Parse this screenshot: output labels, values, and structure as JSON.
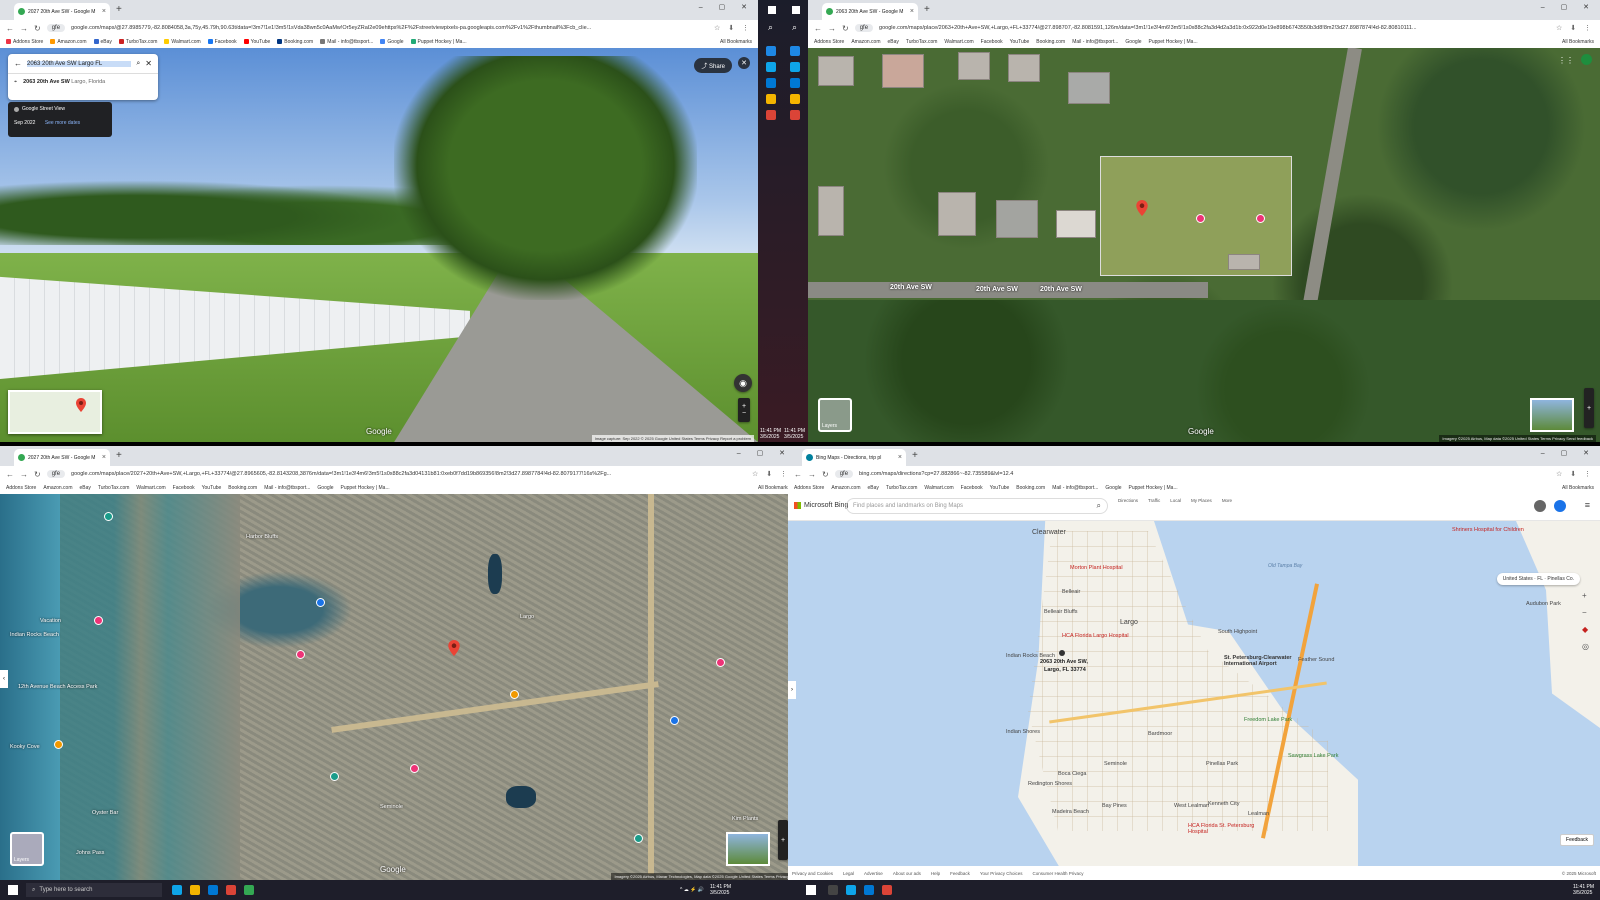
{
  "bookmarks": [
    "Addons Store",
    "Amazon.com",
    "eBay",
    "TurboTax.com",
    "Walmart.com",
    "Facebook",
    "YouTube",
    "Booking.com",
    "Mail - info@tbsport...",
    "Google",
    "Puppet Hockey | Ma..."
  ],
  "all_bookmarks": "All Bookmarks",
  "tl": {
    "tab_title": "2027 20th Ave SW - Google M",
    "url_pill": "gfe",
    "url": "google.com/maps/@27.8985779,-82.8084058,3a,75y,45.79h,90.63t/data=!3m7!1e1!3m5!1sVda38wn5c0AaMw!Or5eyZRaI2e09ehttps%2F%2Fstreetviewpixels-pa.googleapis.com%2Fv1%2Fthumbnail%3Fcb_clie...",
    "search_value": "2063 20th Ave SW Largo FL",
    "suggestion_bold": "2063 20th Ave SW",
    "suggestion_rest": " Largo, Florida",
    "sv_label": "Google Street View",
    "sv_date": "Sep 2022",
    "see_more": "See more dates",
    "share": "Share",
    "watermark": "Google",
    "footer": "Image capture: Sep 2022   © 2025 Google   United States   Terms   Privacy   Report a problem"
  },
  "tr": {
    "tab_title": "2063 20th Ave SW - Google M",
    "url_pill": "gfe",
    "url": "google.com/maps/place/2063+20th+Ave+SW,+Largo,+FL+33774/@27.898707,-82.8081591,126m/data=!3m1!1e3!4m6!3m5!1s0x88c2fa3d4d2a3d1b:0x922d0e19e898b6743550b3d8!8m2!3d27.8987874!4d-82.80810111...",
    "road_labels": [
      "20th Ave SW",
      "20th Ave SW",
      "20th Ave SW"
    ],
    "watermark": "Google",
    "layers": "Layers",
    "footer": "Imagery ©2025 Airbus, Map data ©2025   United States   Terms   Privacy   Send feedback"
  },
  "bl": {
    "tab_title": "2027 20th Ave SW - Google M",
    "url_pill": "gfe",
    "url": "google.com/maps/place/2027+20th+Ave+SW,+Largo,+FL+33774/@27.8965605,-82.8143208,3876m/data=!3m1!1e3!4m6!3m5!1s0x88c2fa3d04131b81:0xeb0f7dd19b869356!8m2!3d27.8987784!4d-82.8079177!16s%2Fg...",
    "labels": [
      "Harbor Bluffs",
      "Indian Rocks Beach",
      "12th Avenue Beach Access Park",
      "Kooky Cove",
      "Vacation",
      "Oyster Bar",
      "Largo",
      "Seminole",
      "Johns Pass",
      "Kim Plants"
    ],
    "watermark": "Google",
    "layers": "Layers",
    "footer": "Imagery ©2025 Airbus, Maxar Technologies, Map data ©2025 Google   United States   Terms   Privacy"
  },
  "br": {
    "tab_title": "Bing Maps - Directions, trip pl",
    "url_pill": "gfe",
    "url": "bing.com/maps/directions?cp=27.882866~-82.735589&lvl=12.4",
    "brand": "Microsoft Bing",
    "search_placeholder": "Find places and landmarks on Bing Maps",
    "nav": [
      "Directions",
      "Traffic",
      "Local",
      "My Places",
      "More"
    ],
    "location_chip": "United States · FL · Pinellas Co.",
    "pin_label_1": "2063 20th Ave SW,",
    "pin_label_2": "Largo, FL 33774",
    "places": [
      "Clearwater",
      "Belleair",
      "Belleair Bluffs",
      "Largo",
      "Indian Rocks Beach",
      "Indian Shores",
      "Seminole",
      "Redington Shores",
      "Madeira Beach",
      "Bay Pines",
      "Pinellas Park",
      "West Lealman",
      "Kenneth City",
      "Lealman",
      "Feather Sound",
      "Bardmoor",
      "Boca Ciega",
      "Audubon Park",
      "Old Tampa Bay",
      "South Highpoint"
    ],
    "airport": "St. Petersburg-Clearwater International Airport",
    "hospital_1": "HCA Florida Largo Hospital",
    "hospital_2": "Morton Plant Hospital",
    "hospital_3": "HCA Florida St. Petersburg Hospital",
    "park_1": "Freedom Lake Park",
    "park_2": "Sawgrass Lake Park",
    "landmark": "Shriners Hospital for Children",
    "feedback": "Feedback",
    "footer_links": [
      "Privacy and Cookies",
      "Legal",
      "Advertise",
      "About our ads",
      "Help",
      "Feedback",
      "Your Privacy Choices",
      "Consumer Health Privacy"
    ],
    "copyright": "© 2025 Microsoft"
  },
  "taskbar": {
    "search_placeholder": "Type here to search",
    "time": "11:41 PM",
    "date": "3/5/2025"
  },
  "colors": {
    "pin_red": "#ea4335",
    "bing_water": "#b9d3ef",
    "land": "#f3f1ea",
    "google_blue": "#1a73e8"
  }
}
